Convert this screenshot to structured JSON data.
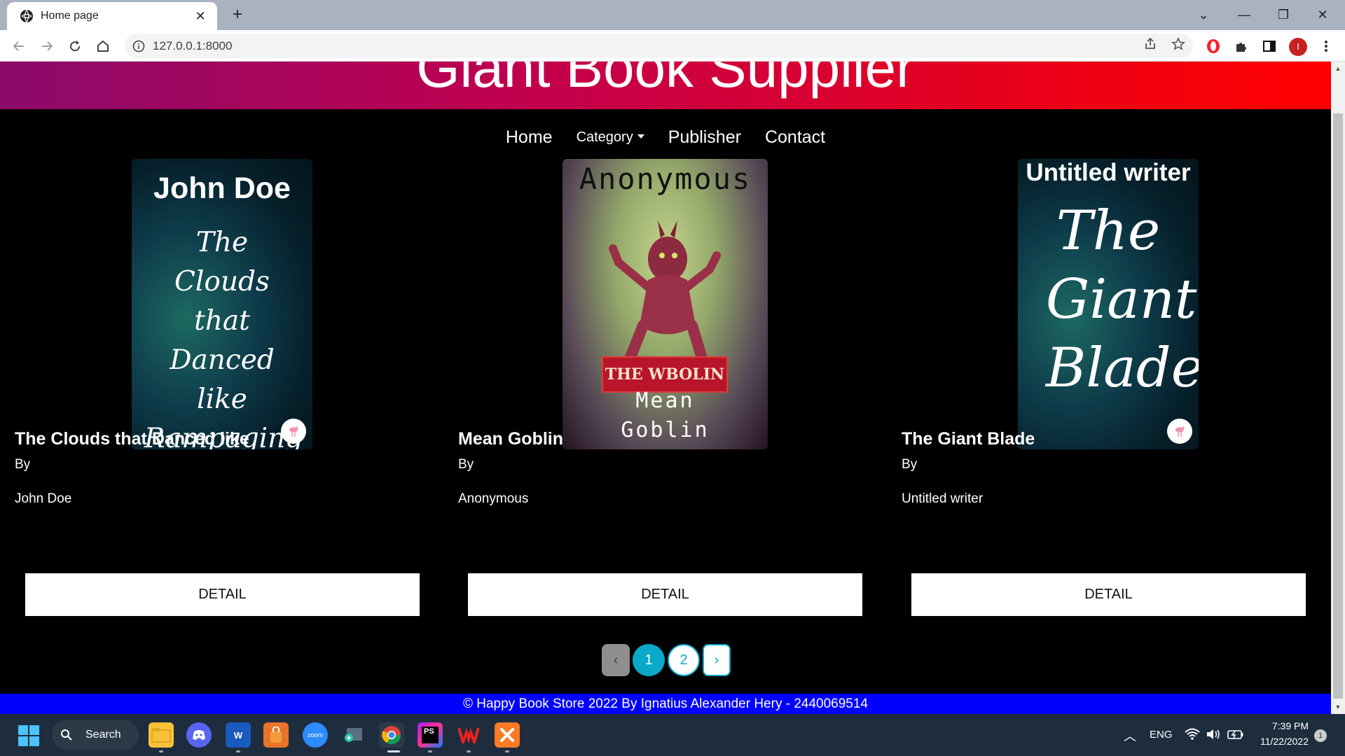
{
  "browser": {
    "tab_title": "Home page",
    "tab_close": "✕",
    "new_tab": "+",
    "url": "127.0.0.1:8000",
    "profile_initial": "I",
    "window_controls": {
      "dropdown": "⌄",
      "minimize": "—",
      "restore": "❐",
      "close": "✕"
    }
  },
  "site": {
    "hero_title": "Giant Book Supplier",
    "nav": {
      "home": "Home",
      "category": "Category",
      "publisher": "Publisher",
      "contact": "Contact"
    },
    "books": [
      {
        "cover_author": "John Doe",
        "cover_title": "The Clouds that Danced like Rampaging Donkeys",
        "title": "The Clouds that Danced like",
        "by": "By",
        "author": "John Doe",
        "button": "DETAIL"
      },
      {
        "cover_author": "Anonymous",
        "cover_banner": "THE WBOLIN",
        "cover_title": "Mean Goblin",
        "title": "Mean Goblin",
        "by": "By",
        "author": "Anonymous",
        "button": "DETAIL"
      },
      {
        "cover_author": "Untitled writer",
        "cover_title": "The Giant Blade",
        "title": "The Giant Blade",
        "by": "By",
        "author": "Untitled writer",
        "button": "DETAIL"
      }
    ],
    "pagination": {
      "prev": "‹",
      "pages": [
        "1",
        "2"
      ],
      "active": "1",
      "next": "›"
    },
    "footer": "© Happy Book Store 2022 By Ignatius Alexander Hery - 2440069514"
  },
  "taskbar": {
    "search_label": "Search",
    "apps": [
      "file-explorer",
      "discord",
      "word",
      "store",
      "zoom",
      "snipping-tool",
      "chrome",
      "phpstorm",
      "wps-office",
      "xampp"
    ],
    "zoom_label": "zoom",
    "word_label": "W",
    "ps_label": "PS",
    "language": "ENG",
    "time": "7:39 PM",
    "date": "11/22/2022",
    "notification_count": "1"
  },
  "colors": {
    "hero_gradient": [
      "#8b0a6a",
      "#ec0016",
      "#ff0000"
    ],
    "footer": "#0000ff",
    "pagination_accent": "#0aa9c9"
  }
}
